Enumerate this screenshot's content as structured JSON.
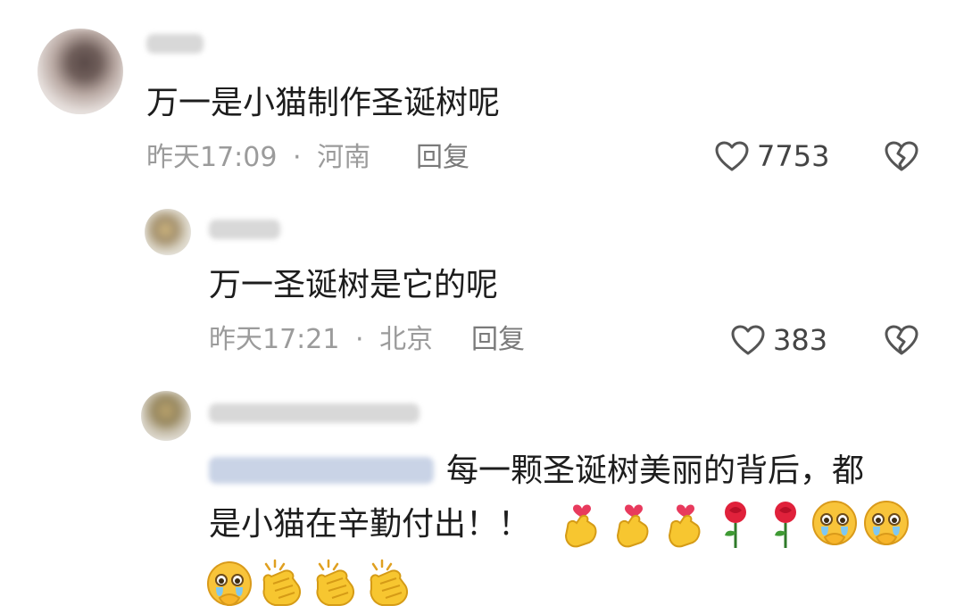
{
  "comments": [
    {
      "text": "万一是小猫制作圣诞树呢",
      "time": "昨天17:09",
      "dot": "·",
      "location": "河南",
      "reply_label": "回复",
      "likes": "7753"
    },
    {
      "text": "万一圣诞树是它的呢",
      "time": "昨天17:21",
      "dot": "·",
      "location": "北京",
      "reply_label": "回复",
      "likes": "383"
    },
    {
      "text_line1": "每一颗圣诞树美丽的背后，都",
      "text_line2": "是小猫在辛勤付出！！",
      "emoji_line1": [
        "heart-hands",
        "heart-hands",
        "heart-hands",
        "rose",
        "rose",
        "crying-face",
        "crying-face"
      ],
      "emoji_line2": [
        "crying-face",
        "clapping-hands",
        "clapping-hands",
        "clapping-hands"
      ]
    }
  ],
  "colors": {
    "text": "#1d1d1d",
    "meta": "#9b9b9b",
    "icon": "#555555"
  }
}
